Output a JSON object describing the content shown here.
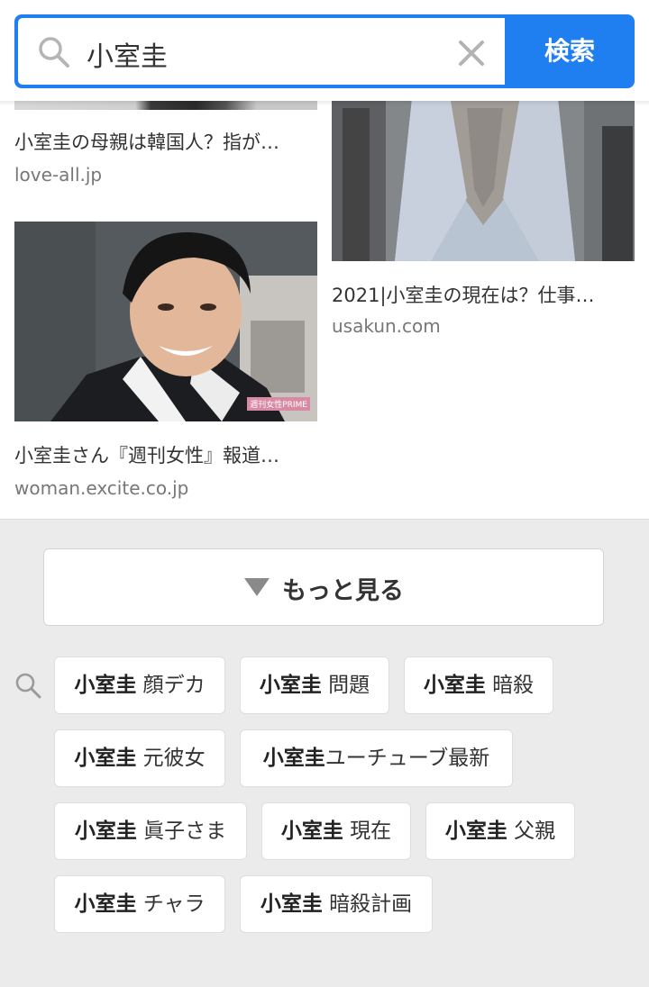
{
  "search": {
    "query": "小室圭",
    "button_label": "検索"
  },
  "results": [
    {
      "title": "小室圭の母親は韓国人？指が…",
      "source": "love-all.jp"
    },
    {
      "title": "2021|小室圭の現在は？仕事…",
      "source": "usakun.com"
    },
    {
      "title": "小室圭さん『週刊女性』報道…",
      "source": "woman.excite.co.jp",
      "watermark": "週刊女性PRIME"
    }
  ],
  "more": {
    "label": "もっと見る"
  },
  "related": [
    {
      "bold": "小室圭",
      "rest": " 顔デカ"
    },
    {
      "bold": "小室圭",
      "rest": " 問題"
    },
    {
      "bold": "小室圭",
      "rest": " 暗殺"
    },
    {
      "bold": "小室圭",
      "rest": " 元彼女"
    },
    {
      "bold": "小室圭",
      "rest": "ユーチューブ最新"
    },
    {
      "bold": "小室圭",
      "rest": " 眞子さま"
    },
    {
      "bold": "小室圭",
      "rest": " 現在"
    },
    {
      "bold": "小室圭",
      "rest": " 父親"
    },
    {
      "bold": "小室圭",
      "rest": " チャラ"
    },
    {
      "bold": "小室圭",
      "rest": " 暗殺計画"
    }
  ],
  "colors": {
    "accent": "#1f7ff0",
    "page_bg": "#ebebeb"
  },
  "icons": [
    "search-icon",
    "clear-icon",
    "triangle-down-icon",
    "related-search-icon"
  ]
}
